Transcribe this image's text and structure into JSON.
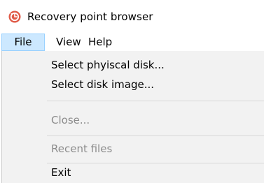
{
  "window": {
    "title": "Recovery point browser",
    "icon": "recovery-app-icon"
  },
  "menubar": {
    "items": [
      {
        "label": "File",
        "active": true
      },
      {
        "label": "View"
      },
      {
        "label": "Help"
      }
    ]
  },
  "file_menu": {
    "items": [
      {
        "label": "Select phyiscal disk...",
        "enabled": true
      },
      {
        "label": "Select disk image...",
        "enabled": true
      },
      {
        "label": "Close...",
        "enabled": false
      },
      {
        "label": "Recent files",
        "enabled": false
      },
      {
        "label": "Exit",
        "enabled": true
      }
    ]
  },
  "colors": {
    "menu_highlight": "#cce8ff",
    "menu_highlight_border": "#99d1ff",
    "dropdown_bg": "#f2f2f2",
    "disabled_text": "#8c8c8c",
    "app_icon": "#e05a47"
  }
}
